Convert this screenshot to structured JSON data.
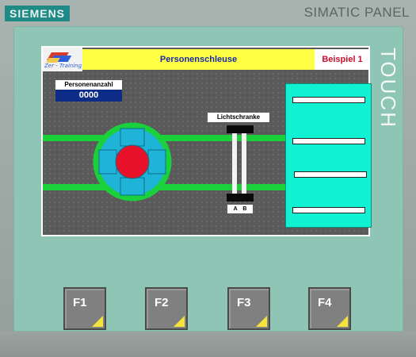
{
  "device": {
    "brand": "SIEMENS",
    "panel_name": "SIMATIC PANEL",
    "touch_label": "TOUCH"
  },
  "hmi": {
    "logo_text": "Zer - Training",
    "title": "Personenschleuse",
    "example": "Beispiel 1",
    "counter": {
      "label": "Personenanzahl",
      "value": "0000"
    },
    "light_barrier": {
      "label": "Lichtschranke",
      "ab": "A B"
    },
    "colors": {
      "lane": "#1ad13c",
      "turnstile_ring": "#1ad13c",
      "turnstile_body": "#1fb3d8",
      "hub": "#e8112a",
      "panel": "#10f2d2",
      "title_bg": "#ffff44"
    }
  },
  "function_keys": [
    "F1",
    "F2",
    "F3",
    "F4"
  ]
}
